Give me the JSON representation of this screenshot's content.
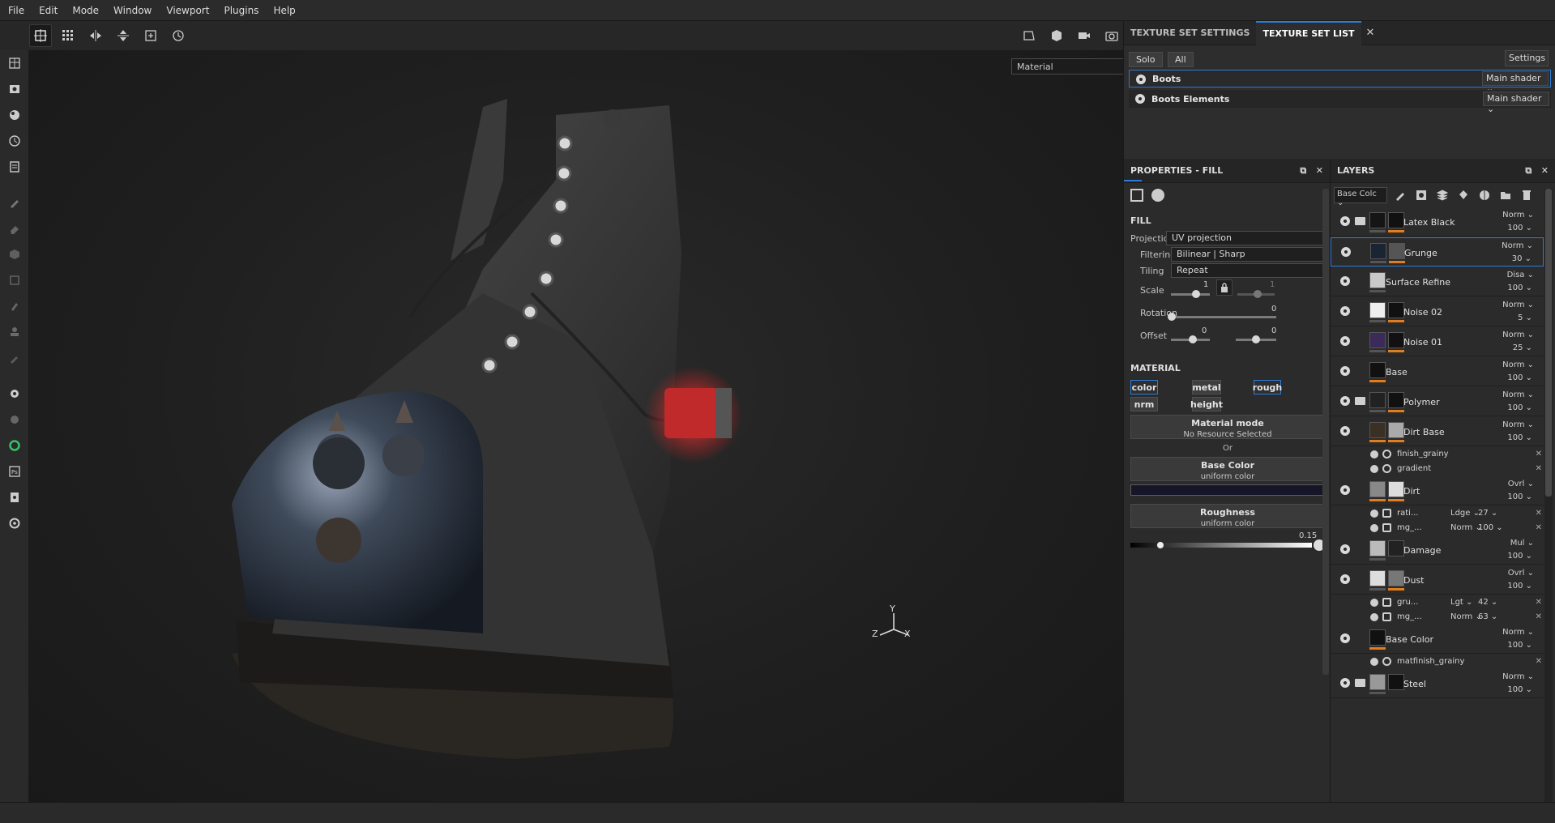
{
  "menu": [
    "File",
    "Edit",
    "Mode",
    "Window",
    "Viewport",
    "Plugins",
    "Help"
  ],
  "viewport": {
    "material_select": "Material",
    "gizmo": {
      "y": "Y",
      "z": "Z",
      "x": "X"
    }
  },
  "texture_set": {
    "tabs": [
      "TEXTURE SET SETTINGS",
      "TEXTURE SET LIST"
    ],
    "solo_label": "Solo",
    "all_label": "All",
    "settings_label": "Settings",
    "sets": [
      {
        "name": "Boots",
        "shader": "Main shader"
      },
      {
        "name": "Boots Elements",
        "shader": "Main shader"
      }
    ]
  },
  "properties": {
    "title": "PROPERTIES - FILL",
    "fill_title": "FILL",
    "projection_label": "Projection",
    "projection_value": "UV projection",
    "filtering_label": "Filtering",
    "filtering_value": "Bilinear | Sharp",
    "tiling_label": "Tiling",
    "tiling_value": "Repeat",
    "scale_label": "Scale",
    "scale_value": "1",
    "scale_value2": "1",
    "rotation_label": "Rotation",
    "rotation_value": "0",
    "offset_label": "Offset",
    "offset_value_u": "0",
    "offset_value_v": "0",
    "material_title": "MATERIAL",
    "channels": [
      "color",
      "metal",
      "rough",
      "nrm",
      "height"
    ],
    "material_mode_title": "Material mode",
    "material_mode_sub": "No Resource Selected",
    "or_label": "Or",
    "base_color_title": "Base Color",
    "base_color_sub": "uniform color",
    "base_color_swatch": "#161628",
    "roughness_title": "Roughness",
    "roughness_sub": "uniform color",
    "roughness_value": "0.15"
  },
  "layers": {
    "title": "LAYERS",
    "channel_select": "Base Colc",
    "items": [
      {
        "name": "Latex Black",
        "blend": "Norm",
        "opacity": "100"
      },
      {
        "name": "Grunge",
        "blend": "Norm",
        "opacity": "30"
      },
      {
        "name": "Surface Refine",
        "blend": "Disa",
        "opacity": "100"
      },
      {
        "name": "Noise 02",
        "blend": "Norm",
        "opacity": "5"
      },
      {
        "name": "Noise 01",
        "blend": "Norm",
        "opacity": "25"
      },
      {
        "name": "Base",
        "blend": "Norm",
        "opacity": "100"
      },
      {
        "name": "Polymer",
        "blend": "Norm",
        "opacity": "100"
      },
      {
        "name": "Dirt Base",
        "blend": "Norm",
        "opacity": "100"
      },
      {
        "name": "Dirt",
        "blend": "Ovrl",
        "opacity": "100"
      },
      {
        "name": "Damage",
        "blend": "Mul",
        "opacity": "100"
      },
      {
        "name": "Dust",
        "blend": "Ovrl",
        "opacity": "100"
      },
      {
        "name": "Base Color",
        "blend": "Norm",
        "opacity": "100"
      },
      {
        "name": "Steel",
        "blend": "Norm",
        "opacity": "100"
      }
    ],
    "subs": {
      "dirt_base_1": "finish_grainy",
      "dirt_base_2": "gradient",
      "dirt_1": "rati...",
      "dirt_1_blend": "Ldge",
      "dirt_1_val": "27",
      "dirt_2": "mg_...",
      "dirt_2_blend": "Norm",
      "dirt_2_val": "100",
      "dust_1": "gru...",
      "dust_1_blend": "Lgt",
      "dust_1_val": "42",
      "dust_2": "mg_...",
      "dust_2_blend": "Norm",
      "dust_2_val": "63",
      "base_color_1": "matfinish_grainy"
    }
  },
  "colors": {
    "accent": "#2e7bd6",
    "mask_orange": "#e17d1f"
  }
}
